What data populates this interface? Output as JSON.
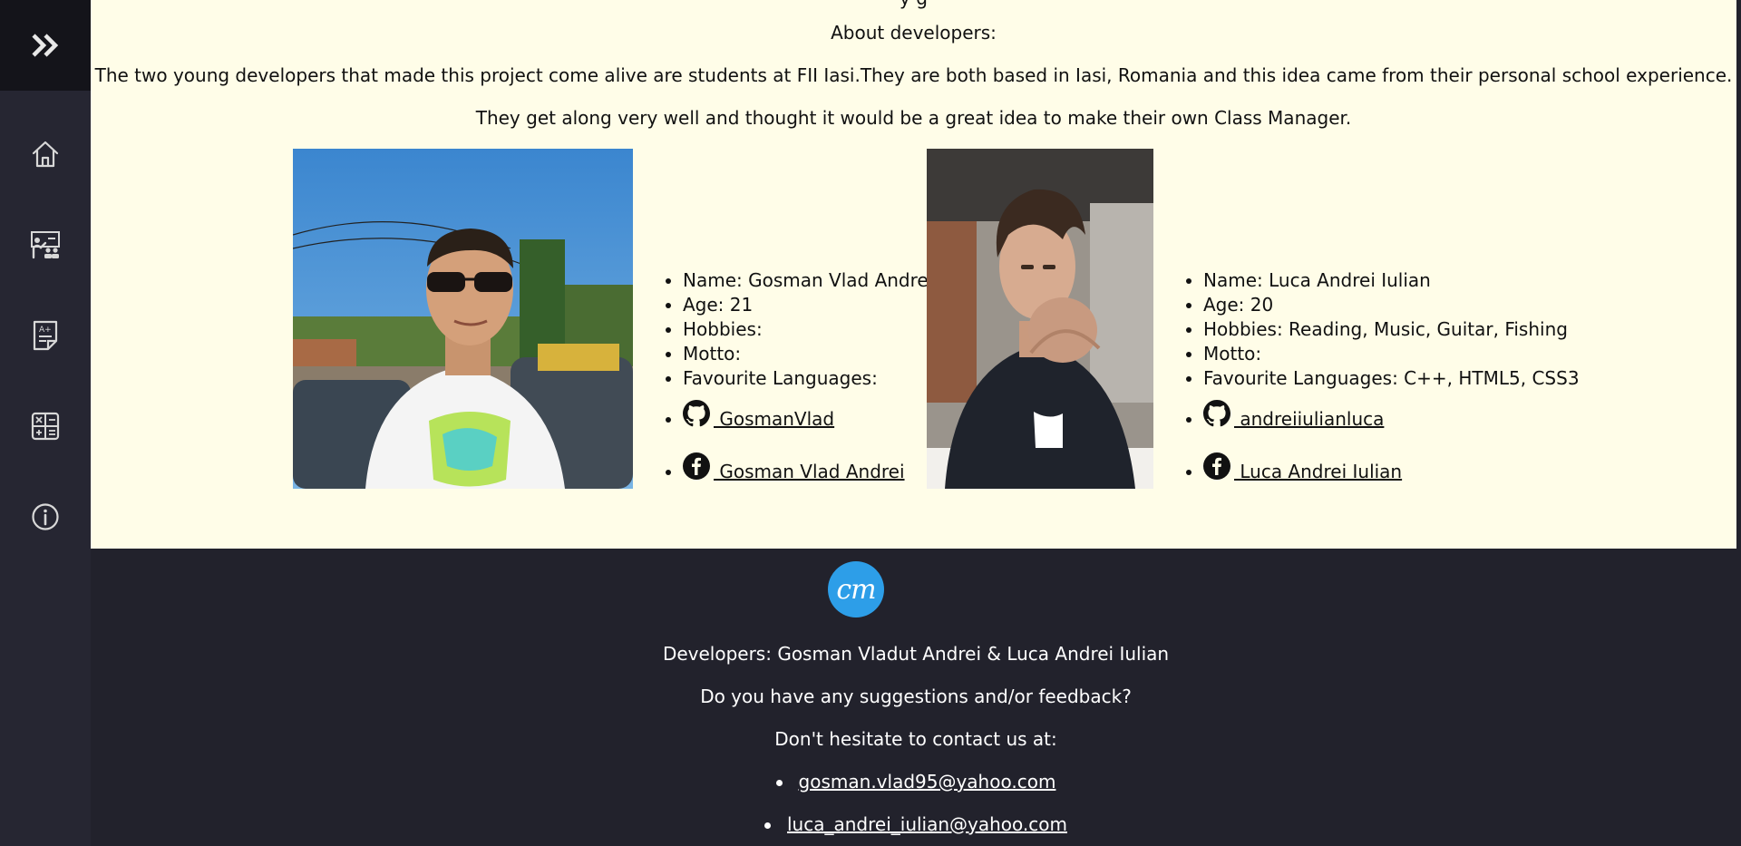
{
  "page": {
    "top_cut_text": "y                   g",
    "about_title": "About developers:",
    "about_paragraph_1": "The two young developers that made this project come alive are students at FII Iasi.They are both based in Iasi, Romania and this idea came from their personal school experience.",
    "about_paragraph_2": "They get along very well and thought it would be a great idea to make their own Class Manager."
  },
  "sidebar": {
    "items": [
      {
        "icon": "home-icon"
      },
      {
        "icon": "classroom-icon"
      },
      {
        "icon": "grades-icon"
      },
      {
        "icon": "calculator-icon"
      },
      {
        "icon": "info-icon"
      }
    ]
  },
  "developers": [
    {
      "name": "Name: Gosman Vlad Andrei",
      "age": "Age: 21",
      "hobbies": "Hobbies:",
      "motto": "Motto:",
      "languages": "Favourite Languages:",
      "github": " GosmanVlad",
      "facebook": " Gosman Vlad Andrei"
    },
    {
      "name": "Name: Luca Andrei Iulian",
      "age": "Age: 20",
      "hobbies": "Hobbies: Reading, Music, Guitar, Fishing",
      "motto": "Motto:",
      "languages": "Favourite Languages: C++, HTML5, CSS3",
      "github": " andreiiulianluca",
      "facebook": " Luca Andrei Iulian"
    }
  ],
  "footer": {
    "logo_text": "cm",
    "developers": "Developers: Gosman Vladut Andrei & Luca Andrei Iulian",
    "suggestions": "Do you have any suggestions and/or feedback?",
    "contact": "Don't hesitate to contact us at:",
    "emails": [
      "gosman.vlad95@yahoo.com",
      "luca_andrei_iulian@yahoo.com"
    ]
  },
  "colors": {
    "sidebar_bg": "#262632",
    "sidebar_top_bg": "#14141a",
    "main_bg": "#fffde8",
    "footer_bg": "#22222c",
    "logo_bg": "#2d9ee8"
  }
}
